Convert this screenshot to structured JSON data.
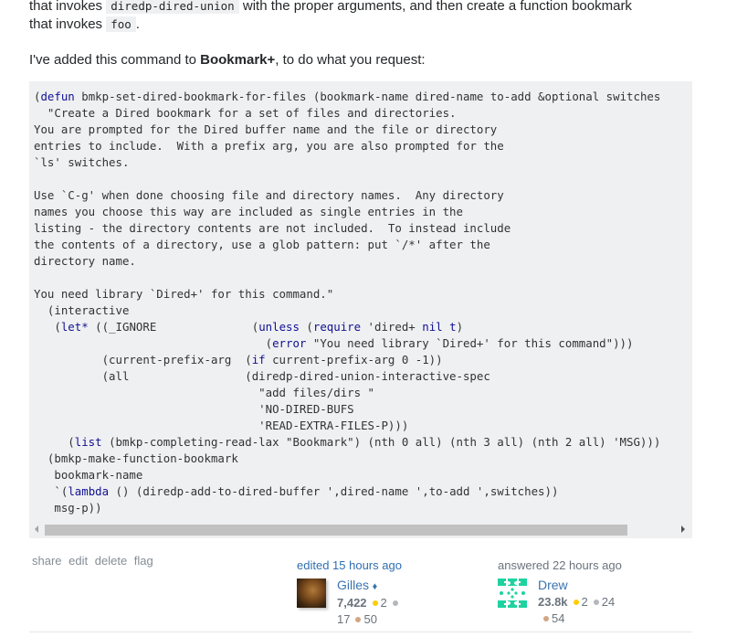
{
  "prose": {
    "line1_before": "that invokes ",
    "line1_code": "diredp-dired-union",
    "line1_after": " with the proper arguments, and then create a function bookmark",
    "line2_before": "that invokes ",
    "line2_code": "foo",
    "line2_after": ".",
    "p2_before": "I've added this command to ",
    "p2_bold": "Bookmark+",
    "p2_after": ", to do what you request:"
  },
  "code": {
    "language": "elisp",
    "lines": [
      "(defun bmkp-set-dired-bookmark-for-files (bookmark-name dired-name to-add &optional switches",
      "  \"Create a Dired bookmark for a set of files and directories.",
      "You are prompted for the Dired buffer name and the file or directory",
      "entries to include.  With a prefix arg, you are also prompted for the",
      "`ls' switches.",
      "",
      "Use `C-g' when done choosing file and directory names.  Any directory",
      "names you choose this way are included as single entries in the",
      "listing - the directory contents are not included.  To instead include",
      "the contents of a directory, use a glob pattern: put `/*' after the",
      "directory name.",
      "",
      "You need library `Dired+' for this command.\"",
      "  (interactive",
      "   (let* ((_IGNORE              (unless (require 'dired+ nil t)",
      "                                  (error \"You need library `Dired+' for this command\")))",
      "          (current-prefix-arg  (if current-prefix-arg 0 -1))",
      "          (all                 (diredp-dired-union-interactive-spec",
      "                                 \"add files/dirs \"",
      "                                 'NO-DIRED-BUFS",
      "                                 'READ-EXTRA-FILES-P)))",
      "     (list (bmkp-completing-read-lax \"Bookmark\") (nth 0 all) (nth 3 all) (nth 2 all) 'MSG)))",
      "  (bmkp-make-function-bookmark",
      "   bookmark-name",
      "   `(lambda () (diredp-add-to-dired-buffer ',dired-name ',to-add ',switches))",
      "   msg-p))"
    ]
  },
  "post_menu": {
    "items": [
      "share",
      "edit",
      "delete",
      "flag"
    ]
  },
  "editor": {
    "action": "edited 15 hours ago",
    "name": "Gilles",
    "moderator_mark": "♦",
    "reputation": "7,422",
    "gold": "2",
    "silver": "17",
    "bronze": "50"
  },
  "author": {
    "action": "answered 22 hours ago",
    "name": "Drew",
    "reputation": "23.8k",
    "gold": "2",
    "silver": "24",
    "bronze": "54"
  },
  "colors": {
    "link": "#3b73af",
    "code_bg": "#eff0f1",
    "keyword": "#101094",
    "gold_badge": "#ffcc01",
    "silver_badge": "#b4b8bc",
    "bronze_badge": "#d1a684",
    "identicon": "#1fd3a0"
  }
}
